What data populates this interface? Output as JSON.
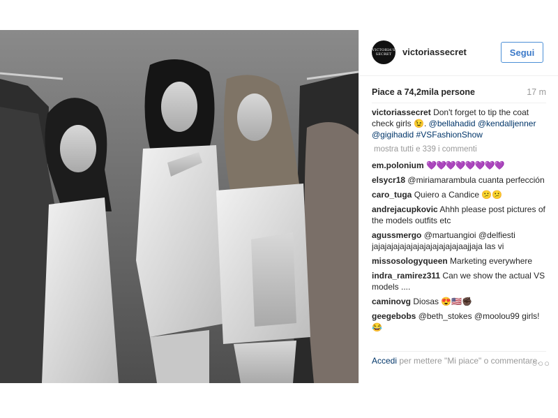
{
  "post": {
    "account": {
      "avatar_text": "VICTORIA'S SECRET",
      "username": "victoriassecret",
      "follow_label": "Segui"
    },
    "likes": "Piace a 74,2mila persone",
    "time": "17 m",
    "caption": {
      "user": "victoriassecret",
      "text": "Don't forget to tip the coat check girls 😉. ",
      "tags": "@bellahadid @kendalljenner @gigihadid #VSFashionShow"
    },
    "more_comments": "mostra tutti e 339 i commenti",
    "comments": [
      {
        "user": "em.polonium",
        "text": "💜💜💜💜💜💜💜💜"
      },
      {
        "user": "elsycr18",
        "text": "@miriamarambula cuanta perfección"
      },
      {
        "user": "caro_tuga",
        "text": "Quiero a Candice 😕😕"
      },
      {
        "user": "andrejacupkovic",
        "text": "Ahhh please post pictures of the models outfits etc"
      },
      {
        "user": "agussmergo",
        "text": "@martuangioi @delfiesti jajajajajajajajajajajajajajaajjaja las vi"
      },
      {
        "user": "missosologyqueen",
        "text": "Marketing everywhere"
      },
      {
        "user": "indra_ramirez311",
        "text": "Can we show the actual VS models ...."
      },
      {
        "user": "caminovg",
        "text": "Diosas 😍🇺🇸✊🏿"
      },
      {
        "user": "geegebobs",
        "text": "@beth_stokes @moolou99 girls! 😂"
      }
    ],
    "login_link": "Accedi",
    "login_text": " per mettere \"Mi piace\" o commentare.",
    "options_icon": "ellipsis-icon",
    "options_glyph": "○○○"
  },
  "colors": {
    "follow_border": "#4b8fd6",
    "follow_text": "#3b79c8",
    "link": "#003569",
    "muted": "#999999"
  }
}
